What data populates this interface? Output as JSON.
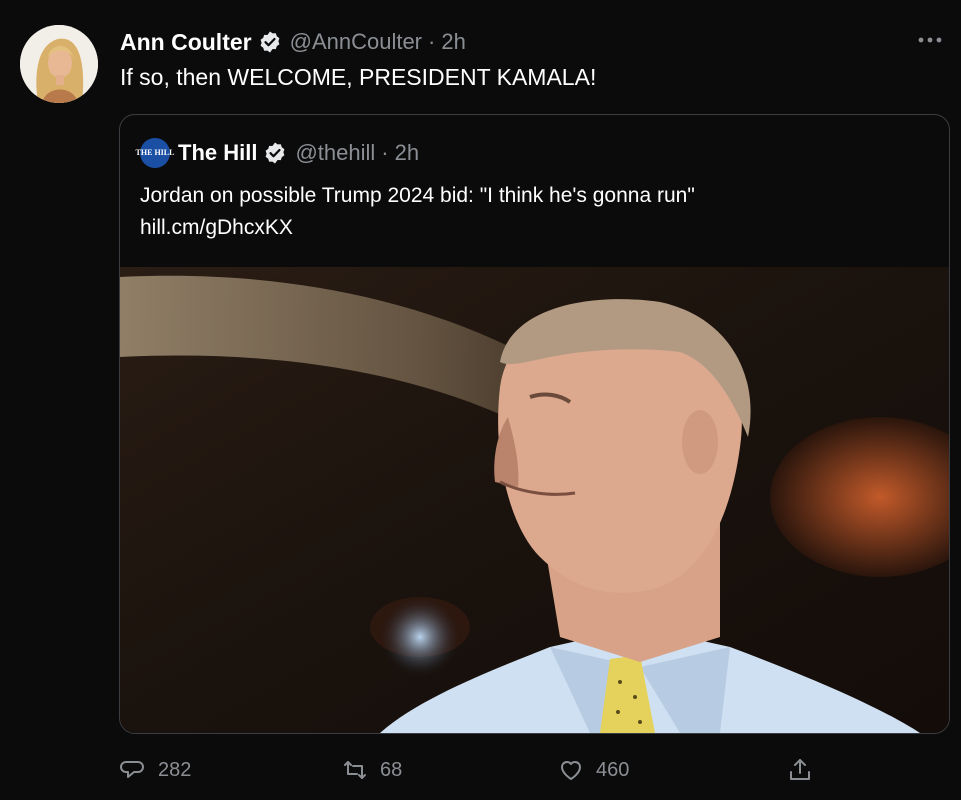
{
  "tweet": {
    "author_name": "Ann Coulter",
    "author_handle": "@AnnCoulter",
    "separator": "·",
    "timestamp": "2h",
    "text": "If so, then WELCOME, PRESIDENT KAMALA!",
    "verified_color": "#e7e9ea"
  },
  "quoted": {
    "author_name": "The Hill",
    "author_handle": "@thehill",
    "timestamp": "2h",
    "logo_text": "THE HILL",
    "text": "Jordan on possible Trump 2024 bid: \"I think he's gonna run\"",
    "link": "hill.cm/gDhcxKX"
  },
  "actions": {
    "replies": "282",
    "retweets": "68",
    "likes": "460"
  },
  "icons": {
    "more": "more-horizontal-icon",
    "reply": "reply-icon",
    "retweet": "retweet-icon",
    "like": "heart-icon",
    "share": "share-icon"
  }
}
